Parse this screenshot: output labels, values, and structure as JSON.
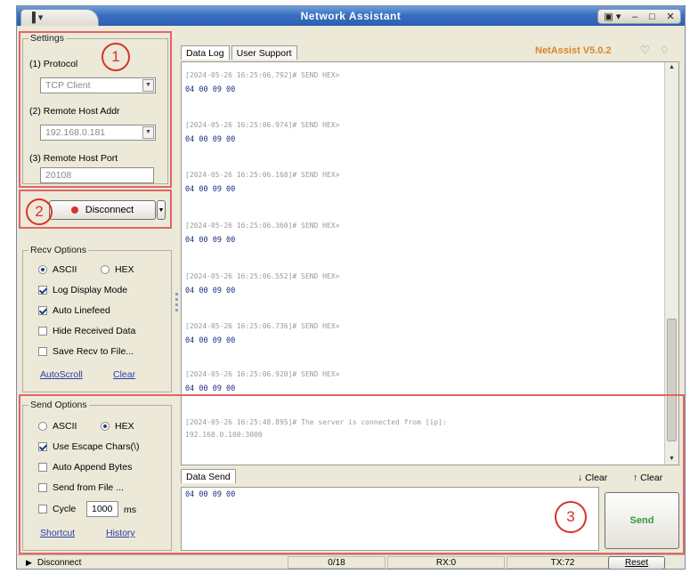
{
  "window": {
    "title": "Network Assistant",
    "system_tab_label": "▐ ▾",
    "controls": [
      "▣ ▾",
      "–",
      "□",
      "✕"
    ]
  },
  "settings": {
    "group_title": "Settings",
    "protocol_label": "(1) Protocol",
    "protocol_value": "TCP Client",
    "host_addr_label": "(2) Remote Host Addr",
    "host_addr_value": "192.168.0.181",
    "host_port_label": "(3) Remote Host Port",
    "host_port_value": "20108",
    "connect_button": "Disconnect"
  },
  "recv_options": {
    "group_title": "Recv Options",
    "ascii": "ASCII",
    "hex": "HEX",
    "encoding_selected": "ASCII",
    "log_display_mode": {
      "label": "Log Display Mode",
      "checked": true
    },
    "auto_linefeed": {
      "label": "Auto Linefeed",
      "checked": true
    },
    "hide_received": {
      "label": "Hide Received Data",
      "checked": false
    },
    "save_recv": {
      "label": "Save Recv to File...",
      "checked": false
    },
    "auto_scroll_link": "AutoScroll",
    "clear_link": "Clear"
  },
  "send_options": {
    "group_title": "Send Options",
    "ascii": "ASCII",
    "hex": "HEX",
    "encoding_selected": "HEX",
    "use_escape": {
      "label": "Use Escape Chars(\\)",
      "checked": true
    },
    "auto_append": {
      "label": "Auto Append Bytes",
      "checked": false
    },
    "send_from_file": {
      "label": "Send from File ...",
      "checked": false
    },
    "cycle": {
      "label": "Cycle",
      "value": "1000",
      "unit": "ms",
      "checked": false
    },
    "shortcut_link": "Shortcut",
    "history_link": "History"
  },
  "tabs": [
    "Data Log",
    "User Support"
  ],
  "version": "NetAssist V5.0.2",
  "log_entries": [
    {
      "ts": "[2024-05-26 16:25:06.792]# SEND HEX>",
      "data": "04 00 09 00"
    },
    {
      "ts": "[2024-05-26 16:25:06.974]# SEND HEX>",
      "data": "04 00 09 00"
    },
    {
      "ts": "[2024-05-26 16:25:06.168]# SEND HEX>",
      "data": "04 00 09 00"
    },
    {
      "ts": "[2024-05-26 16:25:06.360]# SEND HEX>",
      "data": "04 00 09 00"
    },
    {
      "ts": "[2024-05-26 16:25:06.552]# SEND HEX>",
      "data": "04 00 09 00"
    },
    {
      "ts": "[2024-05-26 16:25:06.736]# SEND HEX>",
      "data": "04 00 09 00"
    },
    {
      "ts": "[2024-05-26 16:25:06.920]# SEND HEX>",
      "data": "04 00 09 00"
    }
  ],
  "connected_message": {
    "ts": "[2024-05-26 16:25:48.895]# The server is connected from [ip]:",
    "detail": "192.168.0.100:3000"
  },
  "data_send": {
    "label": "Data Send",
    "clear1": "Clear",
    "clear2": "Clear",
    "content": "04 00 09 00",
    "send_button": "Send"
  },
  "status": {
    "connection": "Disconnect",
    "counter": "0/18",
    "rx": "RX:0",
    "tx": "TX:72",
    "reset": "Reset"
  },
  "annotations": [
    "1",
    "2",
    "3"
  ],
  "colors": {
    "titlebar": "#3a6fc0",
    "annotation_red": "#d9322c",
    "version_orange": "#d9852a",
    "send_green": "#2f9a3a",
    "log_data_blue": "#1c2f80"
  }
}
